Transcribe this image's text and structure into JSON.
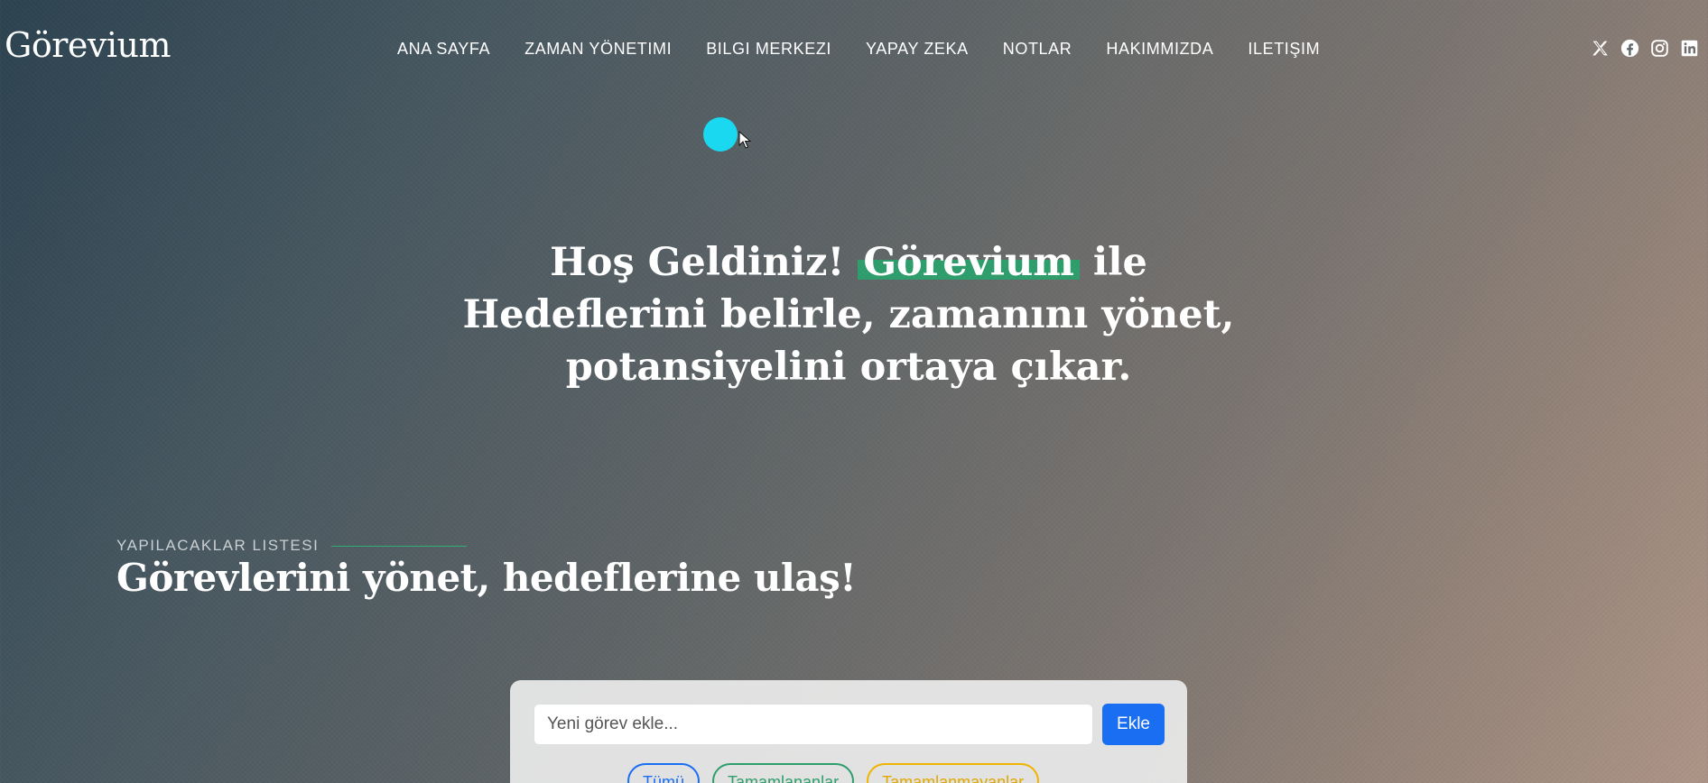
{
  "brand": {
    "logo": "Görevium"
  },
  "nav": {
    "items": [
      {
        "label": "ANA SAYFA"
      },
      {
        "label": "ZAMAN YÖNETIMI"
      },
      {
        "label": "BILGI MERKEZI"
      },
      {
        "label": "YAPAY ZEKA"
      },
      {
        "label": "NOTLAR"
      },
      {
        "label": "HAKIMMIZDA"
      },
      {
        "label": "ILETIŞIM"
      }
    ]
  },
  "social": {
    "icons": [
      "x-icon",
      "facebook-icon",
      "instagram-icon",
      "linkedin-icon"
    ]
  },
  "hero": {
    "welcome": "Hoş Geldiniz!",
    "highlight": "Görevium",
    "after_highlight": "ile",
    "line2": "Hedeflerini belirle, zamanını yönet,",
    "line3": "potansiyelini ortaya çıkar."
  },
  "section": {
    "eyebrow": "YAPILACAKLAR LISTESI",
    "title": "Görevlerini yönet, hedeflerine ulaş!"
  },
  "todo": {
    "input_placeholder": "Yeni görev ekle...",
    "add_label": "Ekle",
    "filters": [
      {
        "label": "Tümü"
      },
      {
        "label": "Tamamlananlar"
      },
      {
        "label": "Tamamlanmayanlar"
      }
    ]
  },
  "colors": {
    "accent_green": "#2e9e6c",
    "primary_blue": "#1a6ef2",
    "warning_yellow": "#f0b400",
    "cursor_cyan": "#1ad8f0"
  }
}
